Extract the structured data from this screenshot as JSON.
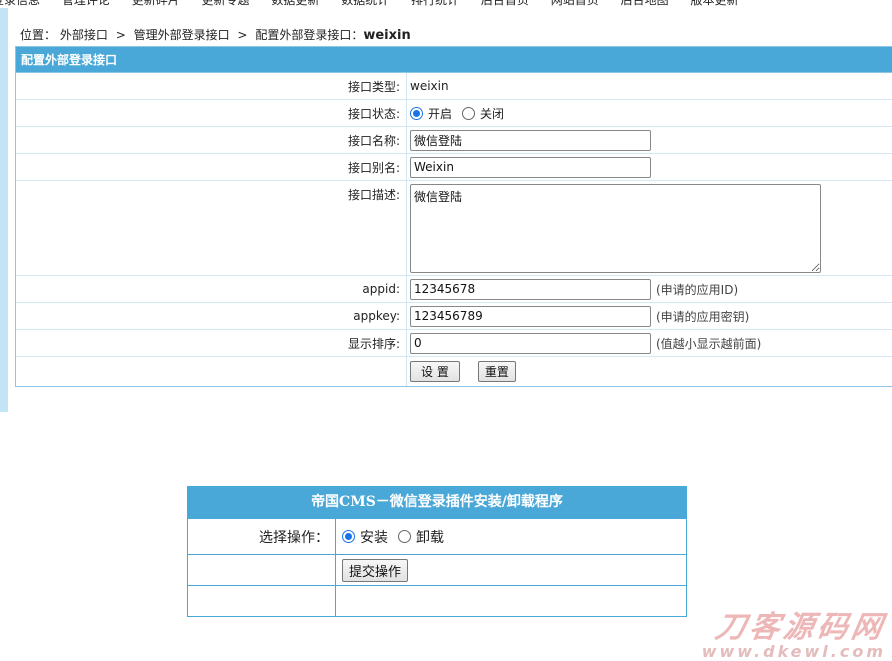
{
  "top_nav": {
    "items": [
      "登录信息",
      "管理评论",
      "更新碎片",
      "更新专题",
      "数据更新",
      "数据统计",
      "排行统计",
      "后台首页",
      "网站首页",
      "后台地图",
      "版本更新"
    ]
  },
  "breadcrumb": {
    "prefix": "位置：",
    "items": [
      "外部接口",
      "管理外部登录接口",
      "配置外部登录接口："
    ],
    "current": "weixin",
    "separator": ">"
  },
  "config_panel": {
    "title": "配置外部登录接口",
    "type_label": "接口类型:",
    "type_value": "weixin",
    "status_label": "接口状态:",
    "status_on": "开启",
    "status_off": "关闭",
    "name_label": "接口名称:",
    "name_value": "微信登陆",
    "alias_label": "接口别名:",
    "alias_value": "Weixin",
    "desc_label": "接口描述:",
    "desc_value": "微信登陆",
    "appid_label": "appid:",
    "appid_value": "12345678",
    "appid_hint": "(申请的应用ID)",
    "appkey_label": "appkey:",
    "appkey_value": "123456789",
    "appkey_hint": "(申请的应用密钥)",
    "order_label": "显示排序:",
    "order_value": "0",
    "order_hint": "(值越小显示越前面)",
    "submit_label": "设 置",
    "reset_label": "重置"
  },
  "install_box": {
    "title": "帝国CMS－微信登录插件安装/卸载程序",
    "select_label": "选择操作：",
    "install_label": "安装",
    "uninstall_label": "卸载",
    "submit_label": "提交操作"
  },
  "watermark": {
    "title": "刀客源码网",
    "url": "www.dkewl.com"
  },
  "colors": {
    "header_blue": "#4aa8d8",
    "border_light": "#d2e8f3",
    "radio_accent": "#1a73e8"
  }
}
